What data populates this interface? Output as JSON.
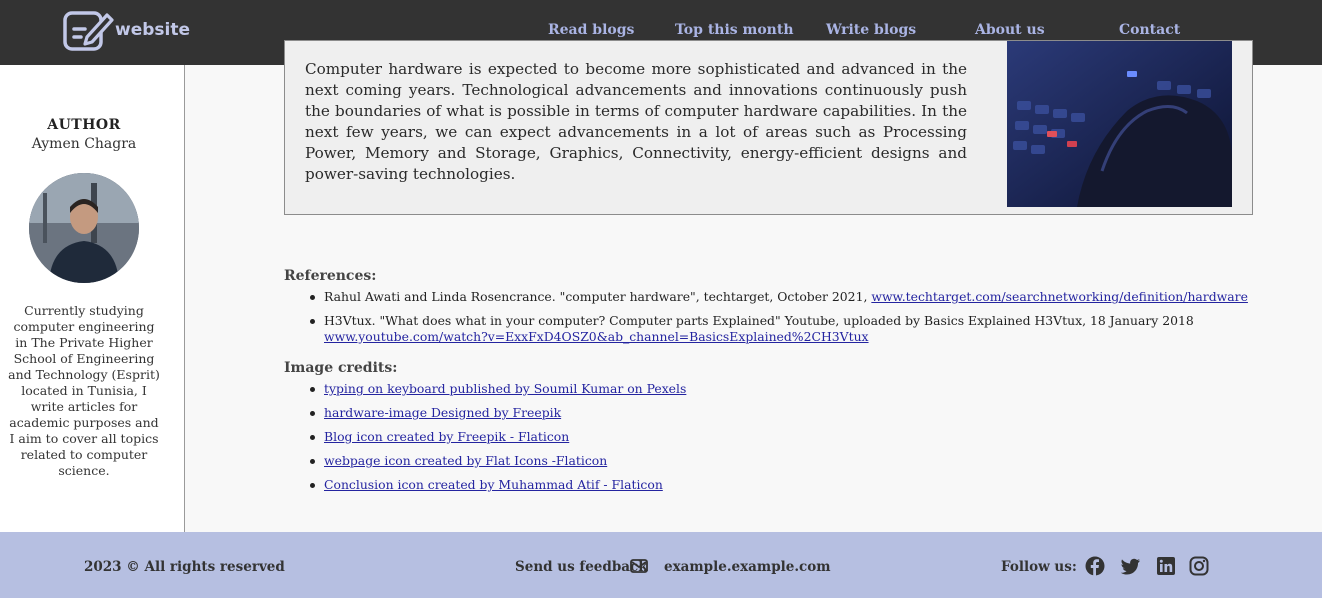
{
  "navbar": {
    "brand": "website",
    "links": [
      "Read blogs",
      "Top this month",
      "Write blogs",
      "About us",
      "Contact"
    ]
  },
  "sidebar": {
    "author_label": "AUTHOR",
    "author_name": "Aymen Chagra",
    "bio": "Currently studying computer engineering in The Private Higher School of Engineering and Technology (Esprit) located in Tunisia, I write articles for academic purposes and I aim to cover all topics related to computer science."
  },
  "article": {
    "paragraph": "Computer hardware is expected to become more sophisticated and advanced in the next coming years. Technological advancements and innovations continuously push the boundaries of what is possible in terms of computer hardware capabilities. In the next few years, we can expect advancements in a lot of areas such as Processing Power, Memory and Storage, Graphics, Connectivity, energy-efficient designs and power-saving technologies."
  },
  "references": {
    "title": "References:",
    "items": [
      {
        "text": "Rahul Awati and Linda Rosencrance. \"computer hardware\", techtarget, October 2021, ",
        "link": "www.techtarget.com/searchnetworking/definition/hardware"
      },
      {
        "text": "H3Vtux. \"What does what in your computer? Computer parts Explained\" Youtube, uploaded by Basics Explained H3Vtux, 18 January 2018",
        "link": "www.youtube.com/watch?v=ExxFxD4OSZ0&ab_channel=BasicsExplained%2CH3Vtux"
      }
    ]
  },
  "image_credits": {
    "title": "Image credits:",
    "items": [
      "typing on keyboard published by Soumil Kumar on Pexels",
      "hardware-image Designed by Freepik",
      "Blog icon created by Freepik - Flaticon",
      "webpage icon created by Flat Icons -Flaticon",
      "Conclusion icon created by Muhammad Atif - Flaticon"
    ]
  },
  "footer": {
    "copyright": "2023 © All rights reserved",
    "feedback_label": "Send us feedback",
    "email": "example.example.com",
    "follow_label": "Follow us:",
    "social_icons": [
      "facebook-icon",
      "twitter-icon",
      "linkedin-icon",
      "instagram-icon"
    ]
  },
  "colors": {
    "navbar_bg": "#333333",
    "nav_link": "#aab4e4",
    "footer_bg": "#b6bfe1",
    "link": "#2424a0"
  }
}
